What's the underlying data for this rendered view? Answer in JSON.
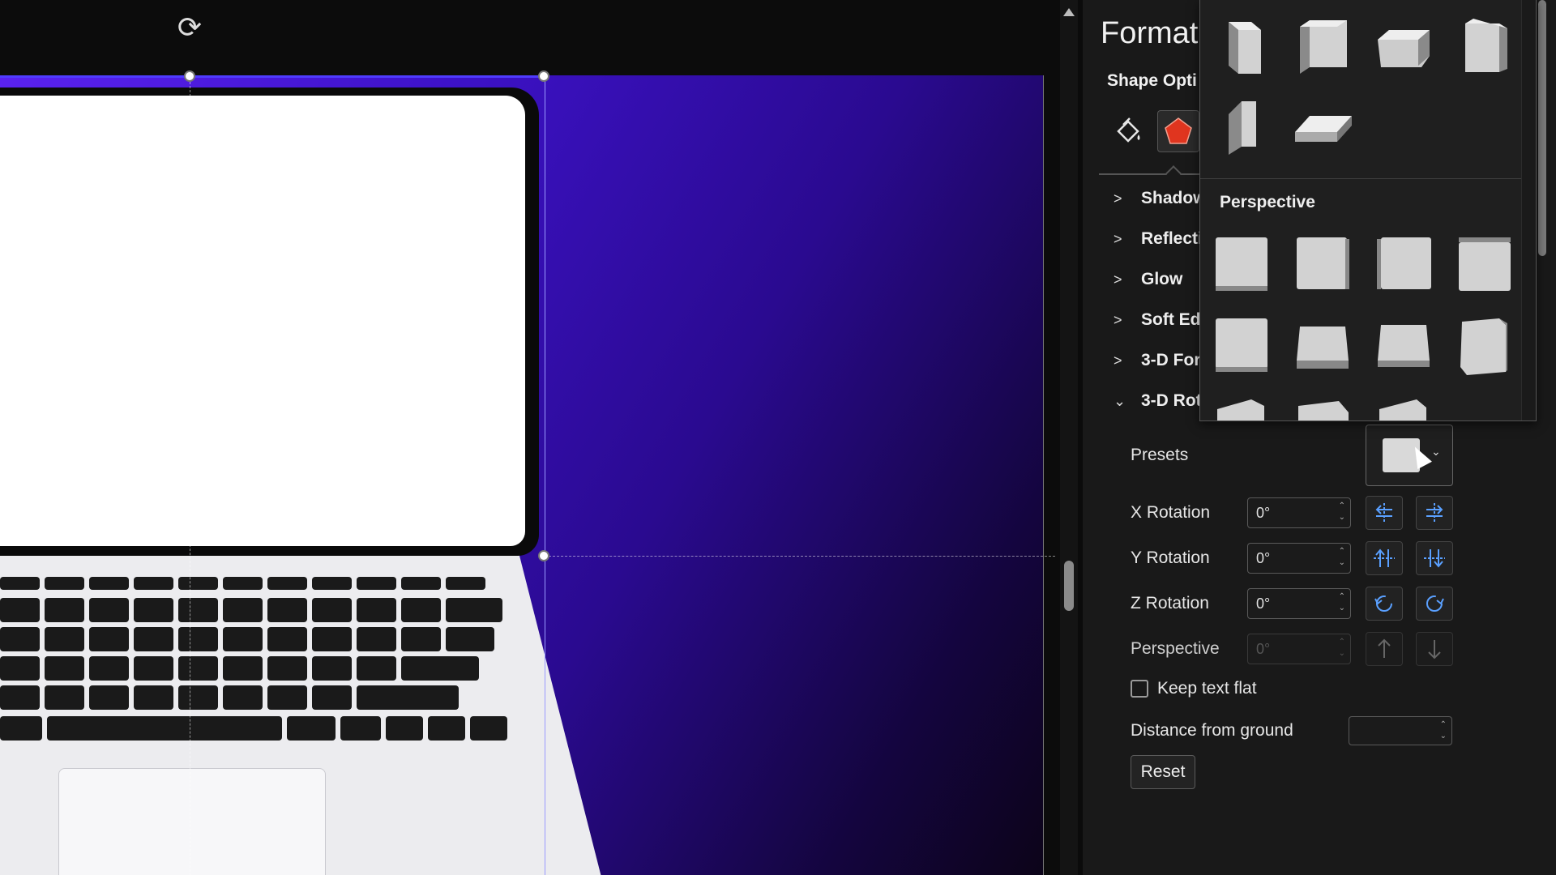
{
  "pane": {
    "title": "Format",
    "subtitle": "Shape Opti",
    "sections": [
      {
        "label": "Shadow",
        "expanded": false
      },
      {
        "label": "Reflectio",
        "expanded": false
      },
      {
        "label": "Glow",
        "expanded": false
      },
      {
        "label": "Soft Edg",
        "expanded": false
      },
      {
        "label": "3-D Form",
        "expanded": false
      },
      {
        "label": "3-D Rota",
        "expanded": true
      }
    ],
    "rotation": {
      "presets_label": "Presets",
      "x_label": "X Rotation",
      "x_value": "0°",
      "y_label": "Y Rotation",
      "y_value": "0°",
      "z_label": "Z Rotation",
      "z_value": "0°",
      "perspective_label": "Perspective",
      "perspective_value": "0°",
      "keep_text_flat_label": "Keep text flat",
      "keep_text_flat_checked": false,
      "distance_label": "Distance from ground",
      "distance_value": "",
      "reset_label": "Reset"
    }
  },
  "gallery": {
    "perspective_heading": "Perspective"
  },
  "colors": {
    "accent_blue": "#5aa0ff",
    "slide_gradient_start": "#5a22f0",
    "slide_gradient_end": "#0c0418",
    "effects_tab_icon": "#e0351f"
  },
  "icons": {
    "fill_tab": "paint-bucket-icon",
    "effects_tab": "pentagon-effects-icon",
    "rotate_handle": "rotate-icon"
  }
}
